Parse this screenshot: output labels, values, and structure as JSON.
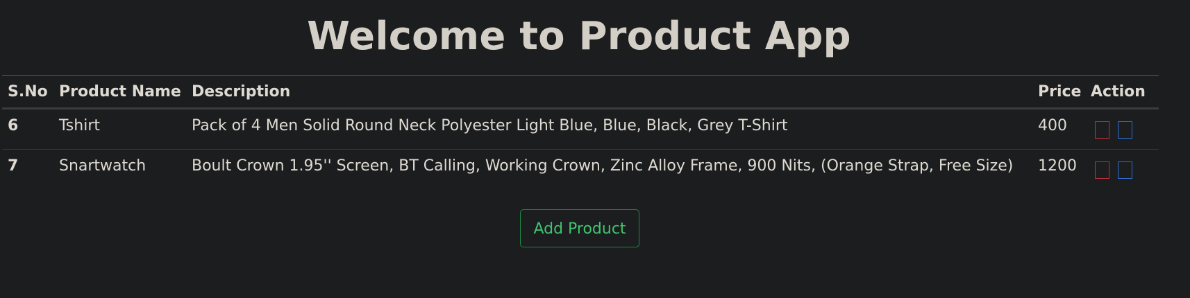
{
  "header": {
    "title": "Welcome to Product App"
  },
  "table": {
    "columns": {
      "sno": "S.No",
      "name": "Product Name",
      "description": "Description",
      "price": "Price",
      "action": "Action"
    },
    "rows": [
      {
        "sno": "6",
        "name": "Tshirt",
        "description": "Pack of 4 Men Solid Round Neck Polyester Light Blue, Blue, Black, Grey T-Shirt",
        "price": "400"
      },
      {
        "sno": "7",
        "name": "Snartwatch",
        "description": "Boult Crown 1.95'' Screen, BT Calling, Working Crown, Zinc Alloy Frame, 900 Nits, (Orange Strap, Free Size)",
        "price": "1200"
      }
    ]
  },
  "footer": {
    "add_label": "Add Product"
  },
  "colors": {
    "background": "#1c1d1f",
    "delete_outline": "#c0303d",
    "edit_outline": "#2f6fd2",
    "add_accent": "#3fc46f"
  },
  "icons": {
    "delete": "delete-icon",
    "edit": "edit-icon"
  }
}
